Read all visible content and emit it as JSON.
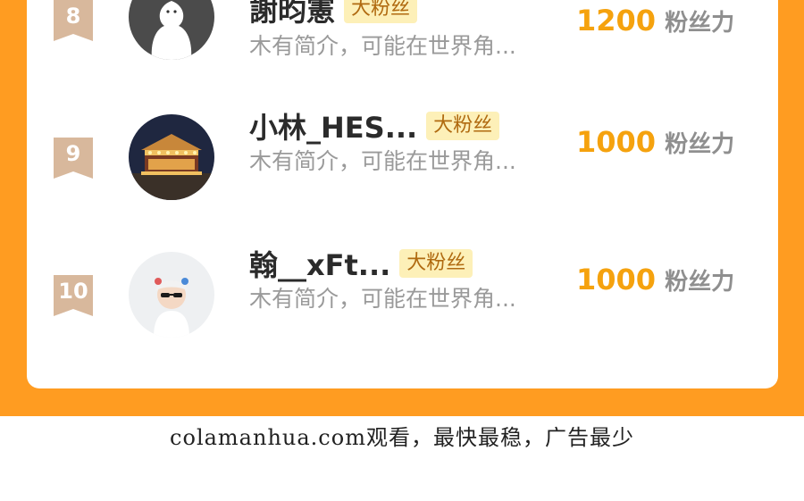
{
  "ranking": {
    "rows": [
      {
        "rank": "8",
        "name": "謝昀憲",
        "badge": "大粉丝",
        "bio": "木有简介，可能在世界角...",
        "score": "1200",
        "unit": "粉丝力",
        "avatar_icon": "default-ghost-avatar"
      },
      {
        "rank": "9",
        "name": "小林_HES...",
        "badge": "大粉丝",
        "bio": "木有简介，可能在世界角...",
        "score": "1000",
        "unit": "粉丝力",
        "avatar_icon": "carousel-photo-avatar"
      },
      {
        "rank": "10",
        "name": "翰__xFt...",
        "badge": "大粉丝",
        "bio": "木有简介，可能在世界角...",
        "score": "1000",
        "unit": "粉丝力",
        "avatar_icon": "child-photo-avatar"
      }
    ]
  },
  "footer": {
    "text": "colamanhua.com观看，最快最稳，广告最少"
  },
  "colors": {
    "frame": "#ff9c21",
    "score": "#f5a20e",
    "badge_bg": "#fdf0b8",
    "rank_badge": "#d8b89c"
  }
}
